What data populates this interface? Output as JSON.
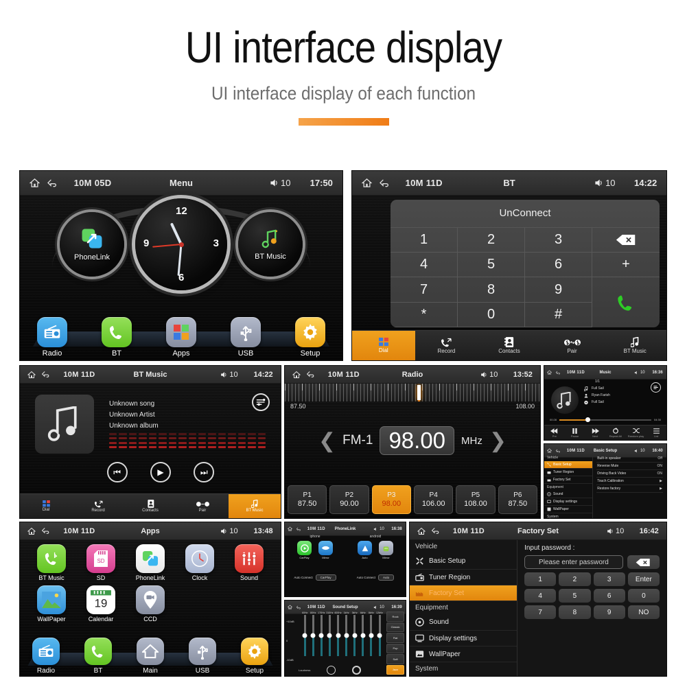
{
  "header": {
    "title": "UI interface display",
    "subtitle": "UI interface display of each function"
  },
  "screens": {
    "menu": {
      "statusbar": {
        "date": "10M 05D",
        "title": "Menu",
        "volume": "10",
        "time": "17:50"
      },
      "widgets": [
        {
          "label": "PhoneLink",
          "icon": "phonelink-icon"
        },
        {
          "label": "Clock",
          "icon": "analog-clock"
        },
        {
          "label": "BT Music",
          "icon": "music-note-icon"
        }
      ],
      "clock_numerals": [
        "12",
        "3",
        "6",
        "9"
      ],
      "dock": [
        {
          "label": "Radio",
          "icon": "radio-icon",
          "color": "#3aa7e8"
        },
        {
          "label": "BT",
          "icon": "phone-icon",
          "color": "#7ed321"
        },
        {
          "label": "Apps",
          "icon": "grid-icon",
          "color": "#9aa0ae"
        },
        {
          "label": "USB",
          "icon": "usb-icon",
          "color": "#9aa0ae"
        },
        {
          "label": "Setup",
          "icon": "gear-icon",
          "color": "#f5b324"
        }
      ]
    },
    "bt": {
      "statusbar": {
        "date": "10M 11D",
        "title": "BT",
        "volume": "10",
        "time": "14:22"
      },
      "connection_status": "UnConnect",
      "keys": [
        "1",
        "2",
        "3",
        "4",
        "5",
        "6",
        "7",
        "8",
        "9",
        "*",
        "0",
        "#"
      ],
      "side_keys": [
        {
          "label": "⌫",
          "name": "backspace-key"
        },
        {
          "label": "+",
          "name": "plus-key"
        },
        {
          "label": "✆",
          "name": "call-key"
        }
      ],
      "tabs": [
        {
          "label": "Dial",
          "icon": "dialpad-icon",
          "active": true
        },
        {
          "label": "Record",
          "icon": "call-record-icon",
          "active": false
        },
        {
          "label": "Contacts",
          "icon": "contacts-icon",
          "active": false
        },
        {
          "label": "Pair",
          "icon": "bluetooth-pair-icon",
          "active": false
        },
        {
          "label": "BT Music",
          "icon": "music-note-icon",
          "active": false
        }
      ]
    },
    "btmusic": {
      "statusbar": {
        "date": "10M 11D",
        "title": "BT Music",
        "volume": "10",
        "time": "14:22"
      },
      "track": {
        "song": "Unknown song",
        "artist": "Unknown Artist",
        "album": "Unknown album"
      },
      "transport": [
        {
          "name": "previous-button",
          "glyph": "⏮"
        },
        {
          "name": "play-button",
          "glyph": "▶"
        },
        {
          "name": "next-button",
          "glyph": "⏭"
        }
      ],
      "tabs": [
        {
          "label": "Dial",
          "icon": "dialpad-icon",
          "active": false
        },
        {
          "label": "Record",
          "icon": "call-record-icon",
          "active": false
        },
        {
          "label": "Contacts",
          "icon": "contacts-icon",
          "active": false
        },
        {
          "label": "Pair",
          "icon": "bluetooth-pair-icon",
          "active": false
        },
        {
          "label": "BT Music",
          "icon": "music-note-icon",
          "active": true
        }
      ]
    },
    "radio": {
      "statusbar": {
        "date": "10M 11D",
        "title": "Radio",
        "volume": "10",
        "time": "13:52"
      },
      "range_min": "87.50",
      "range_max": "108.00",
      "band": "FM-1",
      "frequency": "98.00",
      "unit": "MHz",
      "needle_percent": 52,
      "presets": [
        {
          "name": "P1",
          "freq": "87.50",
          "active": false
        },
        {
          "name": "P2",
          "freq": "90.00",
          "active": false
        },
        {
          "name": "P3",
          "freq": "98.00",
          "active": true
        },
        {
          "name": "P4",
          "freq": "106.00",
          "active": false
        },
        {
          "name": "P5",
          "freq": "108.00",
          "active": false
        },
        {
          "name": "P6",
          "freq": "87.50",
          "active": false
        }
      ]
    },
    "music_small": {
      "statusbar": {
        "date": "10M 11D",
        "title": "Music",
        "volume": "10",
        "time": "16:36"
      },
      "index": "1/1",
      "song": "Full Sail",
      "artist": "Ryan Farish",
      "album": "Full Sail",
      "time_elapsed": "00:28",
      "time_total": "04:30",
      "controls": [
        {
          "label": "Pre",
          "icon": "previous-icon"
        },
        {
          "label": "Pause",
          "icon": "pause-icon"
        },
        {
          "label": "Next",
          "icon": "next-icon"
        },
        {
          "label": "Repeat All",
          "icon": "repeat-icon"
        },
        {
          "label": "Random play",
          "icon": "shuffle-icon"
        },
        {
          "label": "List",
          "icon": "list-icon"
        }
      ]
    },
    "basic_setup": {
      "statusbar": {
        "date": "10M 11D",
        "title": "Basic Setup",
        "volume": "10",
        "time": "16:40"
      },
      "groups": [
        {
          "name": "Vehicle",
          "items": [
            {
              "label": "Basic Setup",
              "icon": "wrench-icon",
              "active": true
            },
            {
              "label": "Tuner Region",
              "icon": "radio-icon",
              "active": false
            },
            {
              "label": "Factory Set",
              "icon": "factory-icon",
              "active": false
            }
          ]
        },
        {
          "name": "Equipment",
          "items": [
            {
              "label": "Sound",
              "icon": "speaker-icon",
              "active": false
            },
            {
              "label": "Display settings",
              "icon": "display-icon",
              "active": false
            },
            {
              "label": "WallPaper",
              "icon": "wallpaper-icon",
              "active": false
            }
          ]
        },
        {
          "name": "System",
          "items": []
        }
      ],
      "rows": [
        {
          "label": "Built-in speaker",
          "value": "Off"
        },
        {
          "label": "Reverse Mute",
          "value": "ON"
        },
        {
          "label": "Driving Back Video",
          "value": "ON"
        },
        {
          "label": "Touch Calibration",
          "value": "▶"
        },
        {
          "label": "Restore factory",
          "value": "▶"
        }
      ]
    },
    "apps": {
      "statusbar": {
        "date": "10M 11D",
        "title": "Apps",
        "volume": "10",
        "time": "13:48"
      },
      "items": [
        {
          "label": "BT Music",
          "icon": "bt-music-icon",
          "color": "#7ed321"
        },
        {
          "label": "SD",
          "icon": "sd-card-icon",
          "color": "#e8529e"
        },
        {
          "label": "PhoneLink",
          "icon": "phonelink-icon",
          "color": "#ffffff"
        },
        {
          "label": "Clock",
          "icon": "clock-icon",
          "color": "#b9c3da"
        },
        {
          "label": "Sound",
          "icon": "sound-mixer-icon",
          "color": "#e8453c"
        },
        {
          "label": "WallPaper",
          "icon": "wallpaper-icon",
          "color": "#5aa9e6"
        },
        {
          "label": "Calendar",
          "icon": "calendar-icon",
          "color": "#ffffff"
        },
        {
          "label": "CCD",
          "icon": "camera-pin-icon",
          "color": "#9aa0ae"
        }
      ],
      "calendar_day": "19",
      "dock": [
        {
          "label": "Radio",
          "icon": "radio-icon",
          "color": "#3aa7e8"
        },
        {
          "label": "BT",
          "icon": "phone-icon",
          "color": "#7ed321"
        },
        {
          "label": "Main",
          "icon": "home-icon",
          "color": "#9aa0ae"
        },
        {
          "label": "USB",
          "icon": "usb-icon",
          "color": "#9aa0ae"
        },
        {
          "label": "Setup",
          "icon": "gear-icon",
          "color": "#f5b324"
        }
      ]
    },
    "phonelink": {
      "statusbar": {
        "date": "10M 11D",
        "title": "PhoneLink",
        "volume": "10",
        "time": "16:38"
      },
      "columns": [
        {
          "head": "iphone",
          "icons": [
            {
              "label": "CarPlay",
              "icon": "carplay-icon",
              "color": "#5fd35f"
            },
            {
              "label": "Mirror",
              "icon": "mirror-icon",
              "color": "#2f8fe0"
            }
          ],
          "auto_label": "Auto Connect",
          "auto_value": "CarPlay"
        },
        {
          "head": "android",
          "icons": [
            {
              "label": "Auto",
              "icon": "android-auto-icon",
              "color": "#2f8fe0"
            },
            {
              "label": "Mirror",
              "icon": "android-mirror-icon",
              "color": "#9aa0ae"
            }
          ],
          "auto_label": "Auto Connect",
          "auto_value": "Auto"
        }
      ]
    },
    "sound_setup": {
      "statusbar": {
        "date": "10M 11D",
        "title": "Sound Setup",
        "volume": "10",
        "time": "16:39"
      },
      "scale_top": "+10dB",
      "scale_mid": "0",
      "scale_bottom": "-10dB",
      "bands": [
        "60Hz",
        "80Hz",
        "170Hz",
        "310Hz",
        "600Hz",
        "1kHz",
        "3kHz",
        "6kHz",
        "8kHz",
        "12kHz"
      ],
      "values": [
        0,
        0,
        0,
        0,
        0,
        0,
        0,
        0,
        0,
        0
      ],
      "presets": [
        {
          "label": "Rock",
          "active": false
        },
        {
          "label": "Classic",
          "active": false
        },
        {
          "label": "Flat",
          "active": false
        },
        {
          "label": "Pop",
          "active": false
        },
        {
          "label": "Soft",
          "active": false
        },
        {
          "label": "Jazz",
          "active": true
        }
      ],
      "loudness_label": "Loudness"
    },
    "factory_set": {
      "statusbar": {
        "date": "10M 11D",
        "title": "Factory Set",
        "volume": "10",
        "time": "16:42"
      },
      "groups": [
        {
          "name": "Vehicle",
          "items": [
            {
              "label": "Basic Setup",
              "icon": "wrench-icon",
              "active": false
            },
            {
              "label": "Tuner Region",
              "icon": "radio-icon",
              "active": false
            },
            {
              "label": "Factory Set",
              "icon": "factory-icon",
              "active": true
            }
          ]
        },
        {
          "name": "Equipment",
          "items": [
            {
              "label": "Sound",
              "icon": "speaker-icon",
              "active": false
            },
            {
              "label": "Display settings",
              "icon": "display-icon",
              "active": false
            },
            {
              "label": "WallPaper",
              "icon": "wallpaper-icon",
              "active": false
            }
          ]
        },
        {
          "name": "System",
          "items": []
        }
      ],
      "input_label": "Input password :",
      "input_placeholder": "Please enter password",
      "input_value": "",
      "keys": [
        "1",
        "2",
        "3",
        "Enter",
        "4",
        "5",
        "6",
        "0",
        "7",
        "8",
        "9",
        "NO"
      ],
      "delete_key": "⌫"
    }
  },
  "colors": {
    "accent": "#f0a11e",
    "accent_dark": "#e2860d",
    "bar_bg": "#2f2f2f"
  }
}
